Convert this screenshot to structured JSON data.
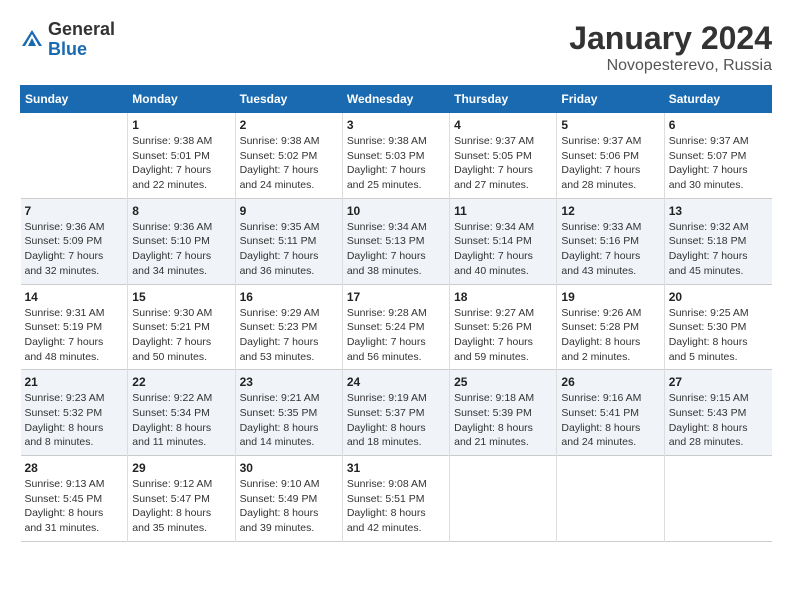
{
  "header": {
    "logo_general": "General",
    "logo_blue": "Blue",
    "title": "January 2024",
    "subtitle": "Novopesterevo, Russia"
  },
  "days_of_week": [
    "Sunday",
    "Monday",
    "Tuesday",
    "Wednesday",
    "Thursday",
    "Friday",
    "Saturday"
  ],
  "weeks": [
    [
      {
        "day": "",
        "info": ""
      },
      {
        "day": "1",
        "info": "Sunrise: 9:38 AM\nSunset: 5:01 PM\nDaylight: 7 hours\nand 22 minutes."
      },
      {
        "day": "2",
        "info": "Sunrise: 9:38 AM\nSunset: 5:02 PM\nDaylight: 7 hours\nand 24 minutes."
      },
      {
        "day": "3",
        "info": "Sunrise: 9:38 AM\nSunset: 5:03 PM\nDaylight: 7 hours\nand 25 minutes."
      },
      {
        "day": "4",
        "info": "Sunrise: 9:37 AM\nSunset: 5:05 PM\nDaylight: 7 hours\nand 27 minutes."
      },
      {
        "day": "5",
        "info": "Sunrise: 9:37 AM\nSunset: 5:06 PM\nDaylight: 7 hours\nand 28 minutes."
      },
      {
        "day": "6",
        "info": "Sunrise: 9:37 AM\nSunset: 5:07 PM\nDaylight: 7 hours\nand 30 minutes."
      }
    ],
    [
      {
        "day": "7",
        "info": "Sunrise: 9:36 AM\nSunset: 5:09 PM\nDaylight: 7 hours\nand 32 minutes."
      },
      {
        "day": "8",
        "info": "Sunrise: 9:36 AM\nSunset: 5:10 PM\nDaylight: 7 hours\nand 34 minutes."
      },
      {
        "day": "9",
        "info": "Sunrise: 9:35 AM\nSunset: 5:11 PM\nDaylight: 7 hours\nand 36 minutes."
      },
      {
        "day": "10",
        "info": "Sunrise: 9:34 AM\nSunset: 5:13 PM\nDaylight: 7 hours\nand 38 minutes."
      },
      {
        "day": "11",
        "info": "Sunrise: 9:34 AM\nSunset: 5:14 PM\nDaylight: 7 hours\nand 40 minutes."
      },
      {
        "day": "12",
        "info": "Sunrise: 9:33 AM\nSunset: 5:16 PM\nDaylight: 7 hours\nand 43 minutes."
      },
      {
        "day": "13",
        "info": "Sunrise: 9:32 AM\nSunset: 5:18 PM\nDaylight: 7 hours\nand 45 minutes."
      }
    ],
    [
      {
        "day": "14",
        "info": "Sunrise: 9:31 AM\nSunset: 5:19 PM\nDaylight: 7 hours\nand 48 minutes."
      },
      {
        "day": "15",
        "info": "Sunrise: 9:30 AM\nSunset: 5:21 PM\nDaylight: 7 hours\nand 50 minutes."
      },
      {
        "day": "16",
        "info": "Sunrise: 9:29 AM\nSunset: 5:23 PM\nDaylight: 7 hours\nand 53 minutes."
      },
      {
        "day": "17",
        "info": "Sunrise: 9:28 AM\nSunset: 5:24 PM\nDaylight: 7 hours\nand 56 minutes."
      },
      {
        "day": "18",
        "info": "Sunrise: 9:27 AM\nSunset: 5:26 PM\nDaylight: 7 hours\nand 59 minutes."
      },
      {
        "day": "19",
        "info": "Sunrise: 9:26 AM\nSunset: 5:28 PM\nDaylight: 8 hours\nand 2 minutes."
      },
      {
        "day": "20",
        "info": "Sunrise: 9:25 AM\nSunset: 5:30 PM\nDaylight: 8 hours\nand 5 minutes."
      }
    ],
    [
      {
        "day": "21",
        "info": "Sunrise: 9:23 AM\nSunset: 5:32 PM\nDaylight: 8 hours\nand 8 minutes."
      },
      {
        "day": "22",
        "info": "Sunrise: 9:22 AM\nSunset: 5:34 PM\nDaylight: 8 hours\nand 11 minutes."
      },
      {
        "day": "23",
        "info": "Sunrise: 9:21 AM\nSunset: 5:35 PM\nDaylight: 8 hours\nand 14 minutes."
      },
      {
        "day": "24",
        "info": "Sunrise: 9:19 AM\nSunset: 5:37 PM\nDaylight: 8 hours\nand 18 minutes."
      },
      {
        "day": "25",
        "info": "Sunrise: 9:18 AM\nSunset: 5:39 PM\nDaylight: 8 hours\nand 21 minutes."
      },
      {
        "day": "26",
        "info": "Sunrise: 9:16 AM\nSunset: 5:41 PM\nDaylight: 8 hours\nand 24 minutes."
      },
      {
        "day": "27",
        "info": "Sunrise: 9:15 AM\nSunset: 5:43 PM\nDaylight: 8 hours\nand 28 minutes."
      }
    ],
    [
      {
        "day": "28",
        "info": "Sunrise: 9:13 AM\nSunset: 5:45 PM\nDaylight: 8 hours\nand 31 minutes."
      },
      {
        "day": "29",
        "info": "Sunrise: 9:12 AM\nSunset: 5:47 PM\nDaylight: 8 hours\nand 35 minutes."
      },
      {
        "day": "30",
        "info": "Sunrise: 9:10 AM\nSunset: 5:49 PM\nDaylight: 8 hours\nand 39 minutes."
      },
      {
        "day": "31",
        "info": "Sunrise: 9:08 AM\nSunset: 5:51 PM\nDaylight: 8 hours\nand 42 minutes."
      },
      {
        "day": "",
        "info": ""
      },
      {
        "day": "",
        "info": ""
      },
      {
        "day": "",
        "info": ""
      }
    ]
  ]
}
